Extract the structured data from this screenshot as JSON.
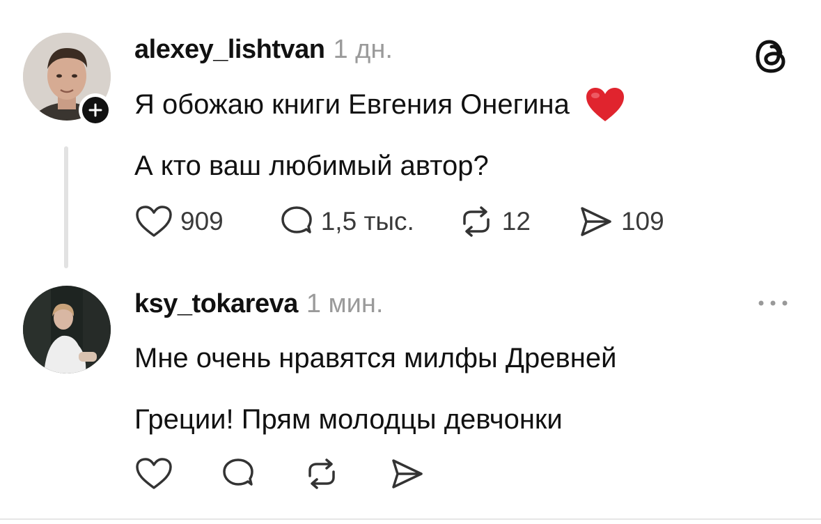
{
  "post": {
    "username": "alexey_lishtvan",
    "time": "1 дн.",
    "line1": "Я обожаю книги Евгения Онегина",
    "emoji": "❤️",
    "line2": "А кто ваш любимый автор?",
    "likes": "909",
    "replies": "1,5 тыс.",
    "reposts": "12",
    "shares": "109"
  },
  "reply": {
    "username": "ksy_tokareva",
    "time": "1 мин.",
    "line1": "Мне очень нравятся милфы Древней",
    "line2": "Греции! Прям молодцы девчонки"
  },
  "icons": {
    "threads_logo": "threads-logo-icon",
    "follow": "plus-icon",
    "like": "heart-icon",
    "reply": "speech-bubble-icon",
    "repost": "repost-icon",
    "share": "send-icon",
    "more": "more-dots-icon"
  },
  "colors": {
    "text": "#111111",
    "muted": "#9a9a9a",
    "heart": "#e0242e"
  }
}
